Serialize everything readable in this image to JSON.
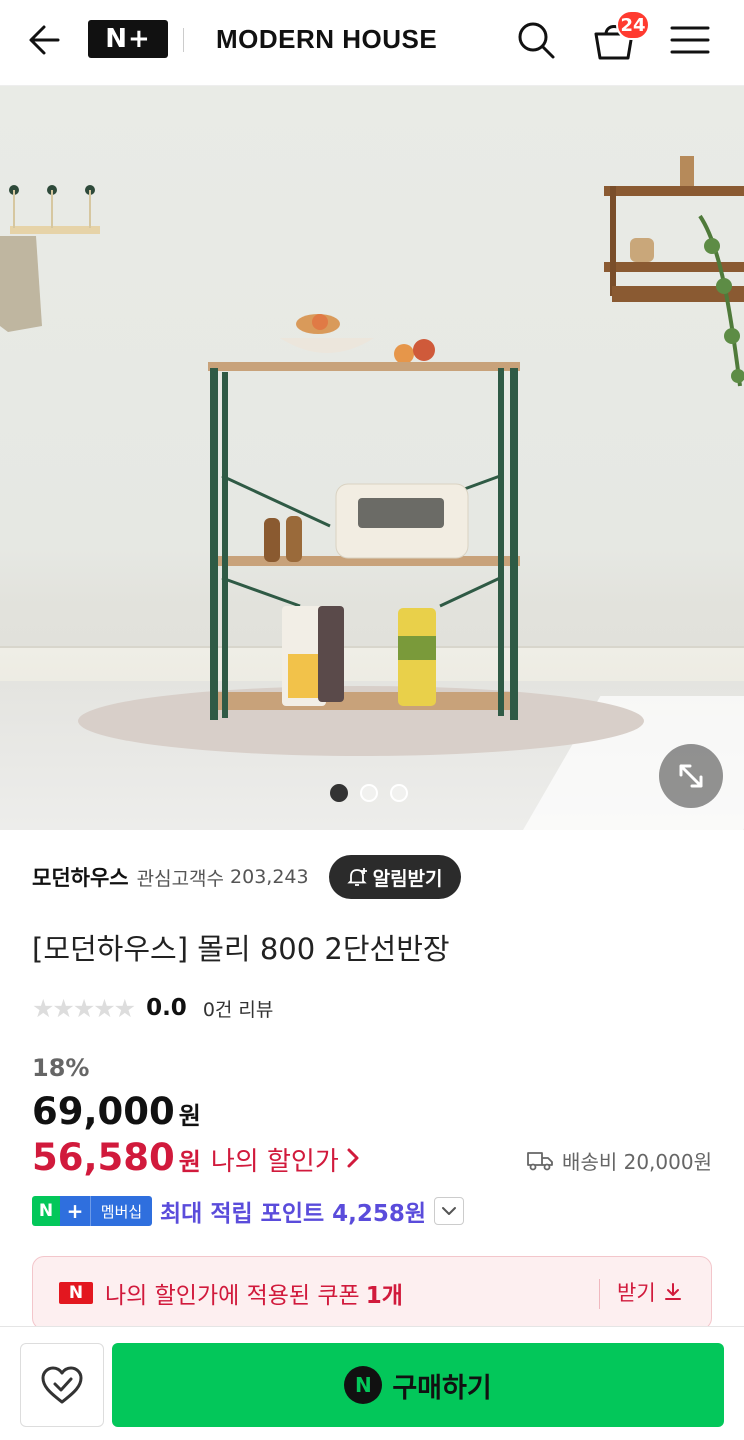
{
  "header": {
    "logo": "N+",
    "brand": "MODERN HOUSE",
    "cart_count": "24"
  },
  "hero": {
    "total_slides": 3,
    "active_slide": 1
  },
  "store": {
    "name": "모던하우스",
    "fans_label": "관심고객수",
    "fans_count": "203,243",
    "alert_label": "알림받기"
  },
  "product": {
    "title": "[모던하우스] 몰리 800 2단선반장",
    "rating_score": "0.0",
    "review_text": "0건 리뷰",
    "discount": "18%",
    "original_price": "69,000",
    "original_unit": "원",
    "sale_price": "56,580",
    "sale_unit": "원",
    "my_price_label": "나의 할인가",
    "shipping": "배송비 20,000원"
  },
  "membership": {
    "badge_text": "멤버십",
    "point_text": "최대 적립 포인트 4,258원"
  },
  "coupon": {
    "icon_text": "N",
    "text": "나의 할인가에 적용된 쿠폰",
    "count": "1개",
    "get_label": "받기"
  },
  "bottom": {
    "buy_label": "구매하기",
    "buy_icon_text": "N"
  },
  "colors": {
    "accent_green": "#03c75a",
    "sale_red": "#d11a3c",
    "point_purple": "#5a4cdb"
  }
}
